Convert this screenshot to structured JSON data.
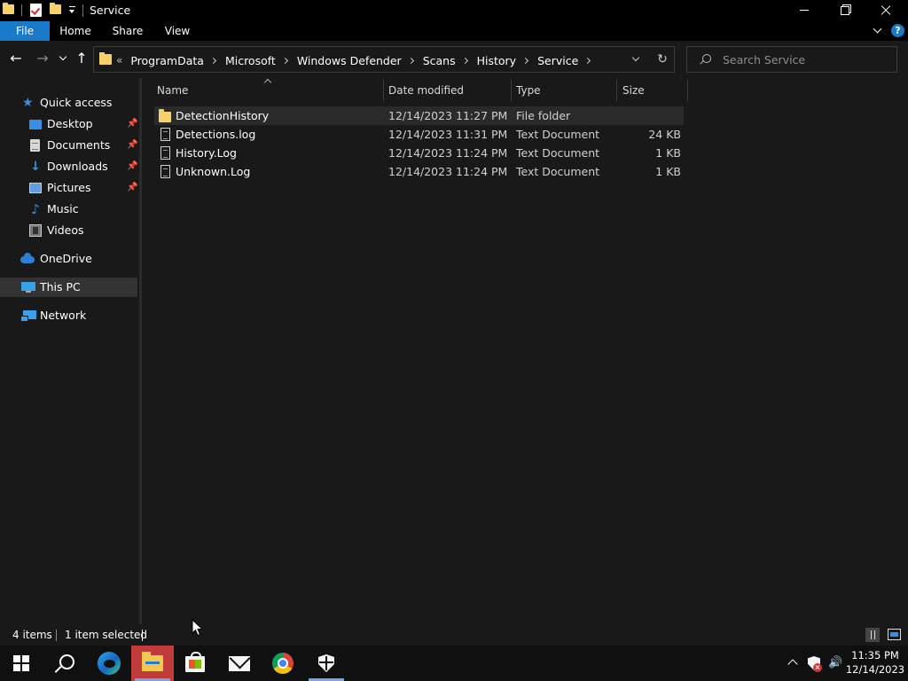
{
  "window": {
    "title": "Service"
  },
  "ribbon": {
    "tabs": [
      {
        "label": "File"
      },
      {
        "label": "Home"
      },
      {
        "label": "Share"
      },
      {
        "label": "View"
      }
    ],
    "help_label": "?"
  },
  "address_bar": {
    "overflow": "«",
    "crumbs": [
      "ProgramData",
      "Microsoft",
      "Windows Defender",
      "Scans",
      "History",
      "Service"
    ]
  },
  "search": {
    "placeholder": "Search Service",
    "value": ""
  },
  "sidebar": {
    "items": [
      {
        "label": "Quick access",
        "icon": "star-icon"
      },
      {
        "label": "Desktop",
        "icon": "desktop-icon",
        "pinned": true
      },
      {
        "label": "Documents",
        "icon": "documents-icon",
        "pinned": true
      },
      {
        "label": "Downloads",
        "icon": "downloads-icon",
        "pinned": true
      },
      {
        "label": "Pictures",
        "icon": "pictures-icon",
        "pinned": true
      },
      {
        "label": "Music",
        "icon": "music-icon"
      },
      {
        "label": "Videos",
        "icon": "videos-icon"
      },
      {
        "label": "OneDrive",
        "icon": "onedrive-icon"
      },
      {
        "label": "This PC",
        "icon": "this-pc-icon",
        "selected": true
      },
      {
        "label": "Network",
        "icon": "network-icon"
      }
    ]
  },
  "file_list": {
    "columns": [
      "Name",
      "Date modified",
      "Type",
      "Size"
    ],
    "rows": [
      {
        "name": "DetectionHistory",
        "date": "12/14/2023 11:27 PM",
        "type": "File folder",
        "size": "",
        "icon": "folder-icon",
        "selected": true
      },
      {
        "name": "Detections.log",
        "date": "12/14/2023 11:31 PM",
        "type": "Text Document",
        "size": "24 KB",
        "icon": "text-file-icon"
      },
      {
        "name": "History.Log",
        "date": "12/14/2023 11:24 PM",
        "type": "Text Document",
        "size": "1 KB",
        "icon": "text-file-icon"
      },
      {
        "name": "Unknown.Log",
        "date": "12/14/2023 11:24 PM",
        "type": "Text Document",
        "size": "1 KB",
        "icon": "text-file-icon"
      }
    ]
  },
  "status": {
    "item_count": "4 items",
    "selection": "1 item selected"
  },
  "taskbar": {
    "apps": [
      "start-icon",
      "search-icon",
      "edge-icon",
      "file-explorer-icon",
      "store-icon",
      "mail-icon",
      "chrome-icon",
      "defender-icon"
    ],
    "clock_time": "11:35 PM",
    "clock_date": "12/14/2023"
  },
  "colors": {
    "accent": "#1979ca",
    "folder": "#f7d26a",
    "background": "#191919",
    "active_taskbar": "#c03c3c"
  }
}
